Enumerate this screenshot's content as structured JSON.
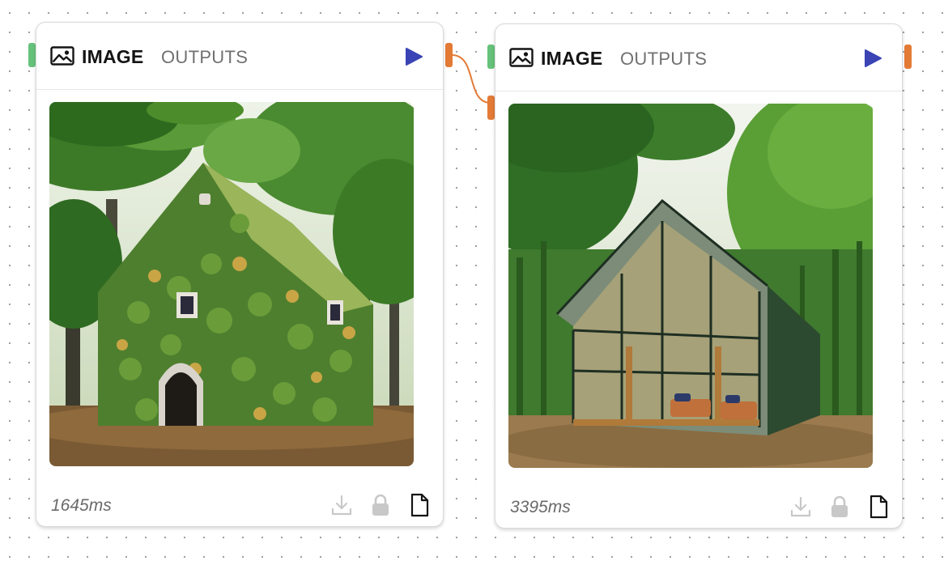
{
  "nodes": [
    {
      "tabs": {
        "active": "IMAGE",
        "inactive": "OUTPUTS"
      },
      "image_alt": "Small cottage covered in green and yellow leaves in a forest",
      "duration": "1645ms"
    },
    {
      "tabs": {
        "active": "IMAGE",
        "inactive": "OUTPUTS"
      },
      "image_alt": "Glass and wood A-frame cabin in a forest",
      "duration": "3395ms"
    }
  ],
  "icons": {
    "header": "image-icon",
    "run": "play-icon",
    "footer": [
      "download-icon",
      "lock-icon",
      "file-icon"
    ]
  },
  "colors": {
    "run_button": "#3a44b4",
    "input_handle": "#66c27a",
    "output_handle": "#e37a36",
    "wire": "#e37a36"
  }
}
